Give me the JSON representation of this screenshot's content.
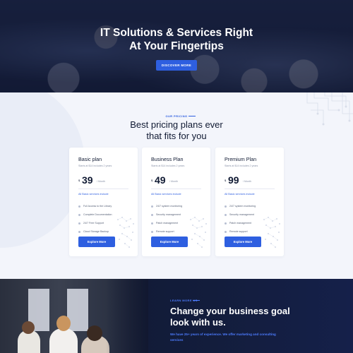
{
  "hero": {
    "title_line1": "IT Solutions & Services Right",
    "title_line2": "At Your Fingertips",
    "button_label": "DISCOVER MORE"
  },
  "pricing": {
    "kicker": "OUR PRICING",
    "title_line1": "Best pricing plans ever",
    "title_line2": "that fits for you",
    "plans": [
      {
        "name": "Basic plan",
        "subtitle": "Starts at $14 includes 2 years",
        "currency": "$",
        "price": "39",
        "period": "/ Month",
        "includes_label": "All Basic services include",
        "features": [
          "Full Access to the Library",
          "Complete Documentation",
          "24/7 Free Support",
          "Cloud Storage Backup"
        ],
        "button_label": "Explore More"
      },
      {
        "name": "Business Plan",
        "subtitle": "Starts at $14 includes 2 years",
        "currency": "$",
        "price": "49",
        "period": "/ Month",
        "includes_label": "All Basic services include",
        "features": [
          "24/7 system monitoring",
          "Security management",
          "Patch management",
          "Remote support"
        ],
        "button_label": "Explore More"
      },
      {
        "name": "Premium Plan",
        "subtitle": "Starts at $14 includes 2 years",
        "currency": "$",
        "price": "99",
        "period": "/ Month",
        "includes_label": "All Basic services include",
        "features": [
          "24/7 system monitoring",
          "Security management",
          "Patch management",
          "Remote support"
        ],
        "button_label": "Explore More"
      }
    ]
  },
  "about": {
    "kicker": "LEARN MORE US",
    "title": "Change your business goal look with us.",
    "subtitle": "We have 25+ years of experience. We offer marketing and consulting services"
  },
  "colors": {
    "accent": "#2e5fe0",
    "hero_bg": "#1d2745",
    "pricing_bg": "#f3f5fb",
    "about_bg": "#0f1730"
  }
}
